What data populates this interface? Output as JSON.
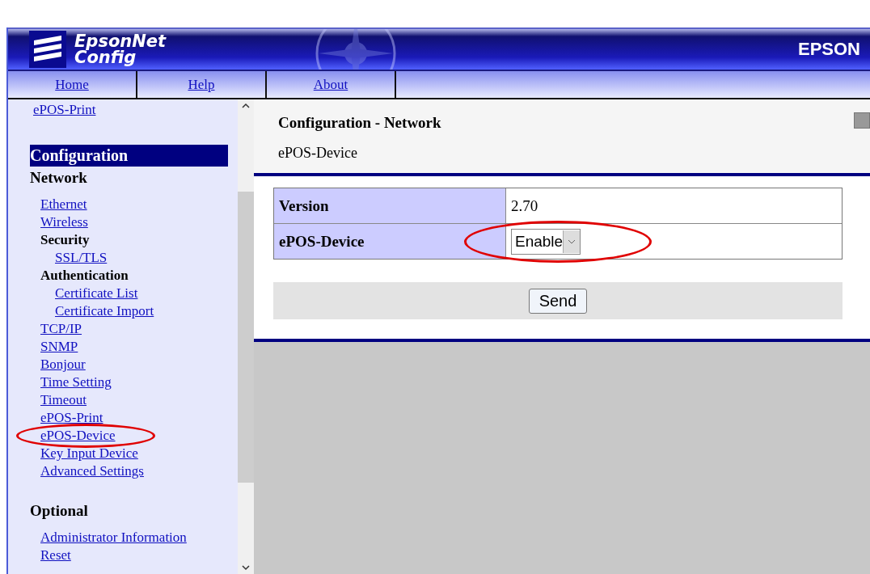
{
  "header": {
    "logo_line_1": "EpsonNet",
    "logo_line_2": "Config",
    "brand": "EPSON"
  },
  "nav": [
    {
      "label": "Home"
    },
    {
      "label": "Help"
    },
    {
      "label": "About"
    }
  ],
  "sidebar": {
    "items": [
      {
        "kind": "link",
        "label": "ePOS-Print",
        "circled": false
      },
      {
        "kind": "section",
        "label": "Configuration"
      },
      {
        "kind": "group",
        "label": "Network",
        "children": [
          {
            "kind": "link",
            "label": "Ethernet",
            "circled": false
          },
          {
            "kind": "link",
            "label": "Wireless",
            "circled": false
          },
          {
            "kind": "subgroup",
            "label": "Security",
            "children": [
              {
                "kind": "link",
                "label": "SSL/TLS",
                "circled": false
              }
            ]
          },
          {
            "kind": "subgroup",
            "label": "Authentication",
            "children": [
              {
                "kind": "link",
                "label": "Certificate List",
                "circled": false
              },
              {
                "kind": "link",
                "label": "Certificate Import",
                "circled": false
              }
            ]
          },
          {
            "kind": "link",
            "label": "TCP/IP",
            "circled": false
          },
          {
            "kind": "link",
            "label": "SNMP",
            "circled": false
          },
          {
            "kind": "link",
            "label": "Bonjour",
            "circled": false
          },
          {
            "kind": "link",
            "label": "Time Setting",
            "circled": false
          },
          {
            "kind": "link",
            "label": "Timeout",
            "circled": false
          },
          {
            "kind": "link",
            "label": "ePOS-Print",
            "circled": false
          },
          {
            "kind": "link",
            "label": "ePOS-Device",
            "circled": true
          },
          {
            "kind": "link",
            "label": "Key Input Device",
            "circled": false
          },
          {
            "kind": "link",
            "label": "Advanced Settings",
            "circled": false
          }
        ]
      },
      {
        "kind": "group",
        "label": "Optional",
        "children": [
          {
            "kind": "link",
            "label": "Administrator Information",
            "circled": false
          },
          {
            "kind": "link",
            "label": "Reset",
            "circled": false
          }
        ]
      }
    ]
  },
  "content": {
    "title": "Configuration - Network",
    "subtitle": "ePOS-Device",
    "rows": [
      {
        "label": "Version",
        "kind": "text",
        "value": "2.70",
        "circled": false
      },
      {
        "label": "ePOS-Device",
        "kind": "select",
        "value": "Enable",
        "circled": true
      }
    ],
    "button": "Send"
  }
}
